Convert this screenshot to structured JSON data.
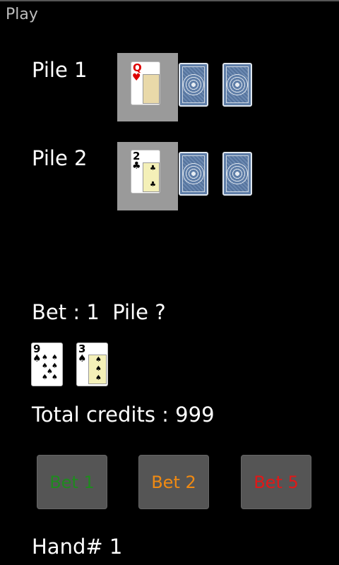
{
  "app": {
    "title": "Play"
  },
  "piles": [
    {
      "label": "Pile 1",
      "face_card": {
        "rank": "Q",
        "suit": "♥",
        "suit_color": "red"
      },
      "hidden_cards": 2
    },
    {
      "label": "Pile 2",
      "face_card": {
        "rank": "2",
        "suit": "♣",
        "suit_color": "black"
      },
      "hidden_cards": 2
    }
  ],
  "bet_status": "Bet : 1  Pile ?",
  "player_hand": [
    {
      "rank": "9",
      "suit": "♠",
      "suit_color": "black"
    },
    {
      "rank": "3",
      "suit": "♠",
      "suit_color": "black"
    }
  ],
  "total_credits_text": "Total credits : 999",
  "buttons": {
    "bet1": {
      "label": "Bet 1",
      "color": "#1f8a1f"
    },
    "bet2": {
      "label": "Bet 2",
      "color": "#f08a12"
    },
    "bet5": {
      "label": "Bet 5",
      "color": "#e01818"
    }
  },
  "hand_number_text": "Hand# 1",
  "colors": {
    "background": "#000000",
    "button_bg": "#555555",
    "card_back": "#5f7ea8",
    "pile_highlight": "#9a9a9a"
  }
}
